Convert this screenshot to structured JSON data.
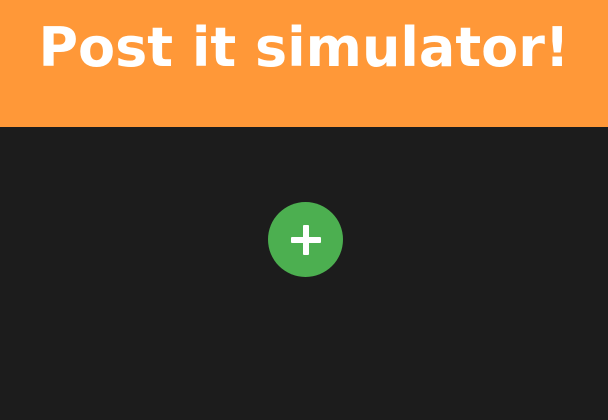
{
  "header": {
    "title": "Post it simulator!"
  },
  "toolbar": {
    "add_button_icon": "plus-icon"
  },
  "colors": {
    "header_background": "#ff9838",
    "page_background": "#1c1c1c",
    "add_button_background": "#4caf50",
    "text": "#ffffff"
  }
}
